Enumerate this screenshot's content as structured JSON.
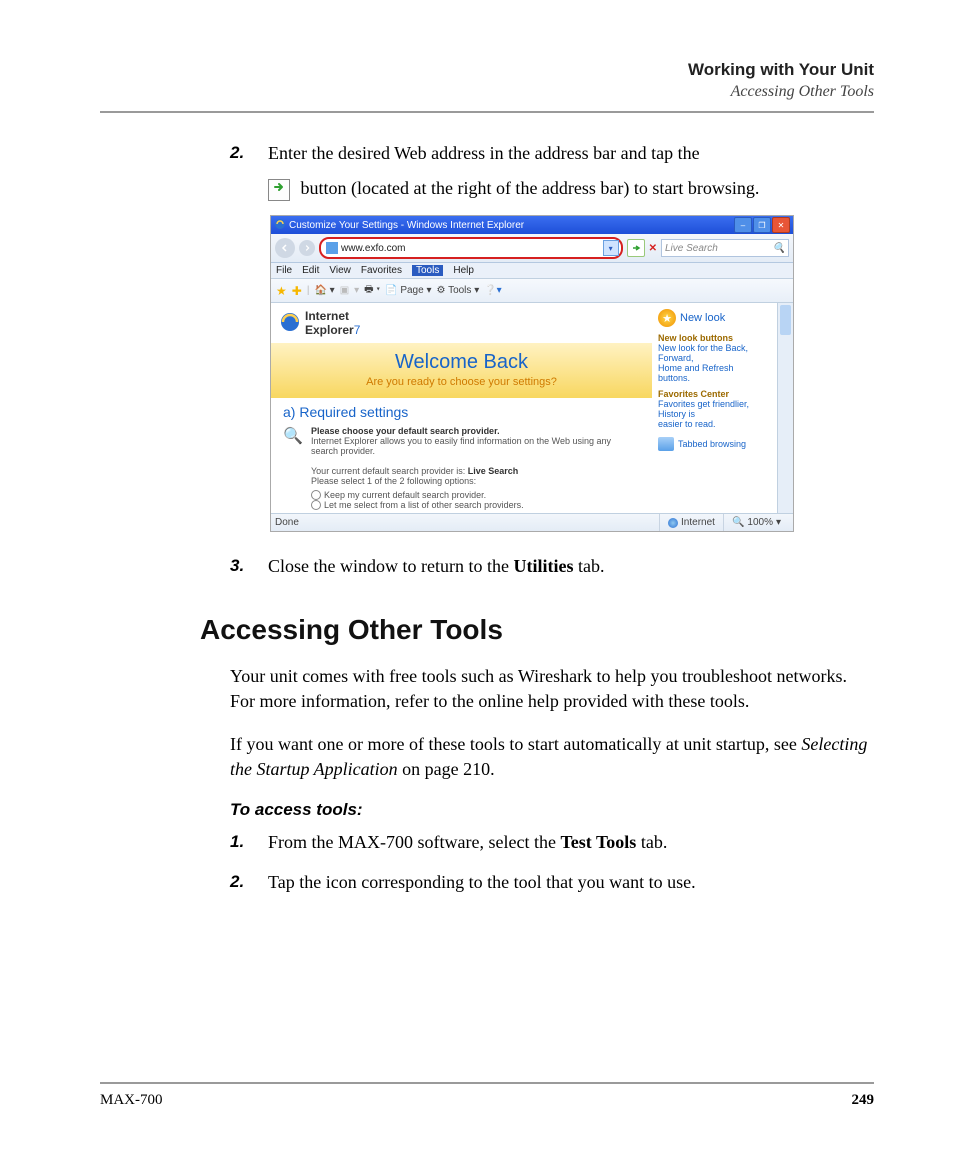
{
  "header": {
    "title": "Working with Your Unit",
    "subtitle": "Accessing Other Tools"
  },
  "step2": {
    "num": "2.",
    "line1": "Enter the desired Web address in the address bar and tap the ",
    "line2": " button (located at the right of the address bar) to start browsing."
  },
  "ie": {
    "title": "Customize Your Settings - Windows Internet Explorer",
    "address": "www.exfo.com",
    "search_placeholder": "Live Search",
    "menu": {
      "file": "File",
      "edit": "Edit",
      "view": "View",
      "favorites": "Favorites",
      "tools": "Tools",
      "help": "Help"
    },
    "toolbar": {
      "page": "Page",
      "tools": "Tools"
    },
    "logo_text1": "Internet",
    "logo_text2": "Explorer",
    "logo_num": "7",
    "welcome": "Welcome Back",
    "welcome_sub": "Are you ready to choose your settings?",
    "req_heading": "a) Required settings",
    "req_bold": "Please choose your default search provider.",
    "req_body1": "Internet Explorer allows you to easily find information on the Web using any search provider.",
    "req_body2a": "Your current default search provider is: ",
    "req_body2b": "Live Search",
    "req_body3": "Please select 1 of the 2 following options:",
    "opt1": "Keep my current default search provider.",
    "opt2": "Let me select from a list of other search providers.",
    "sidebar": {
      "newlook": "New look",
      "block1_title": "New look buttons",
      "block1_l1": "New look for the Back,",
      "block1_l2": "Forward,",
      "block1_l3": "Home and Refresh",
      "block1_l4": "buttons.",
      "block2_title": "Favorites Center",
      "block2_l1": "Favorites get friendlier,",
      "block2_l2": "History is",
      "block2_l3": "easier to read.",
      "tabbed": "Tabbed browsing"
    },
    "status": {
      "done": "Done",
      "internet": "Internet",
      "zoom": "100%"
    }
  },
  "step3": {
    "num": "3.",
    "text_a": "Close the window to return to the ",
    "text_b": "Utilities",
    "text_c": " tab."
  },
  "section_heading": "Accessing Other Tools",
  "para1": "Your unit comes with free tools such as Wireshark to help you troubleshoot networks. For more information, refer to the online help provided with these tools.",
  "para2_a": "If you want one or more of these tools to start automatically at unit startup, see ",
  "para2_i": "Selecting the Startup Application",
  "para2_b": " on page 210.",
  "subhead": "To access tools:",
  "access_step1": {
    "num": "1.",
    "a": "From the MAX-700 software, select the ",
    "b": "Test Tools",
    "c": " tab."
  },
  "access_step2": {
    "num": "2.",
    "a": "Tap the icon corresponding to the tool that you want to use."
  },
  "footer": {
    "left": "MAX-700",
    "right": "249"
  }
}
